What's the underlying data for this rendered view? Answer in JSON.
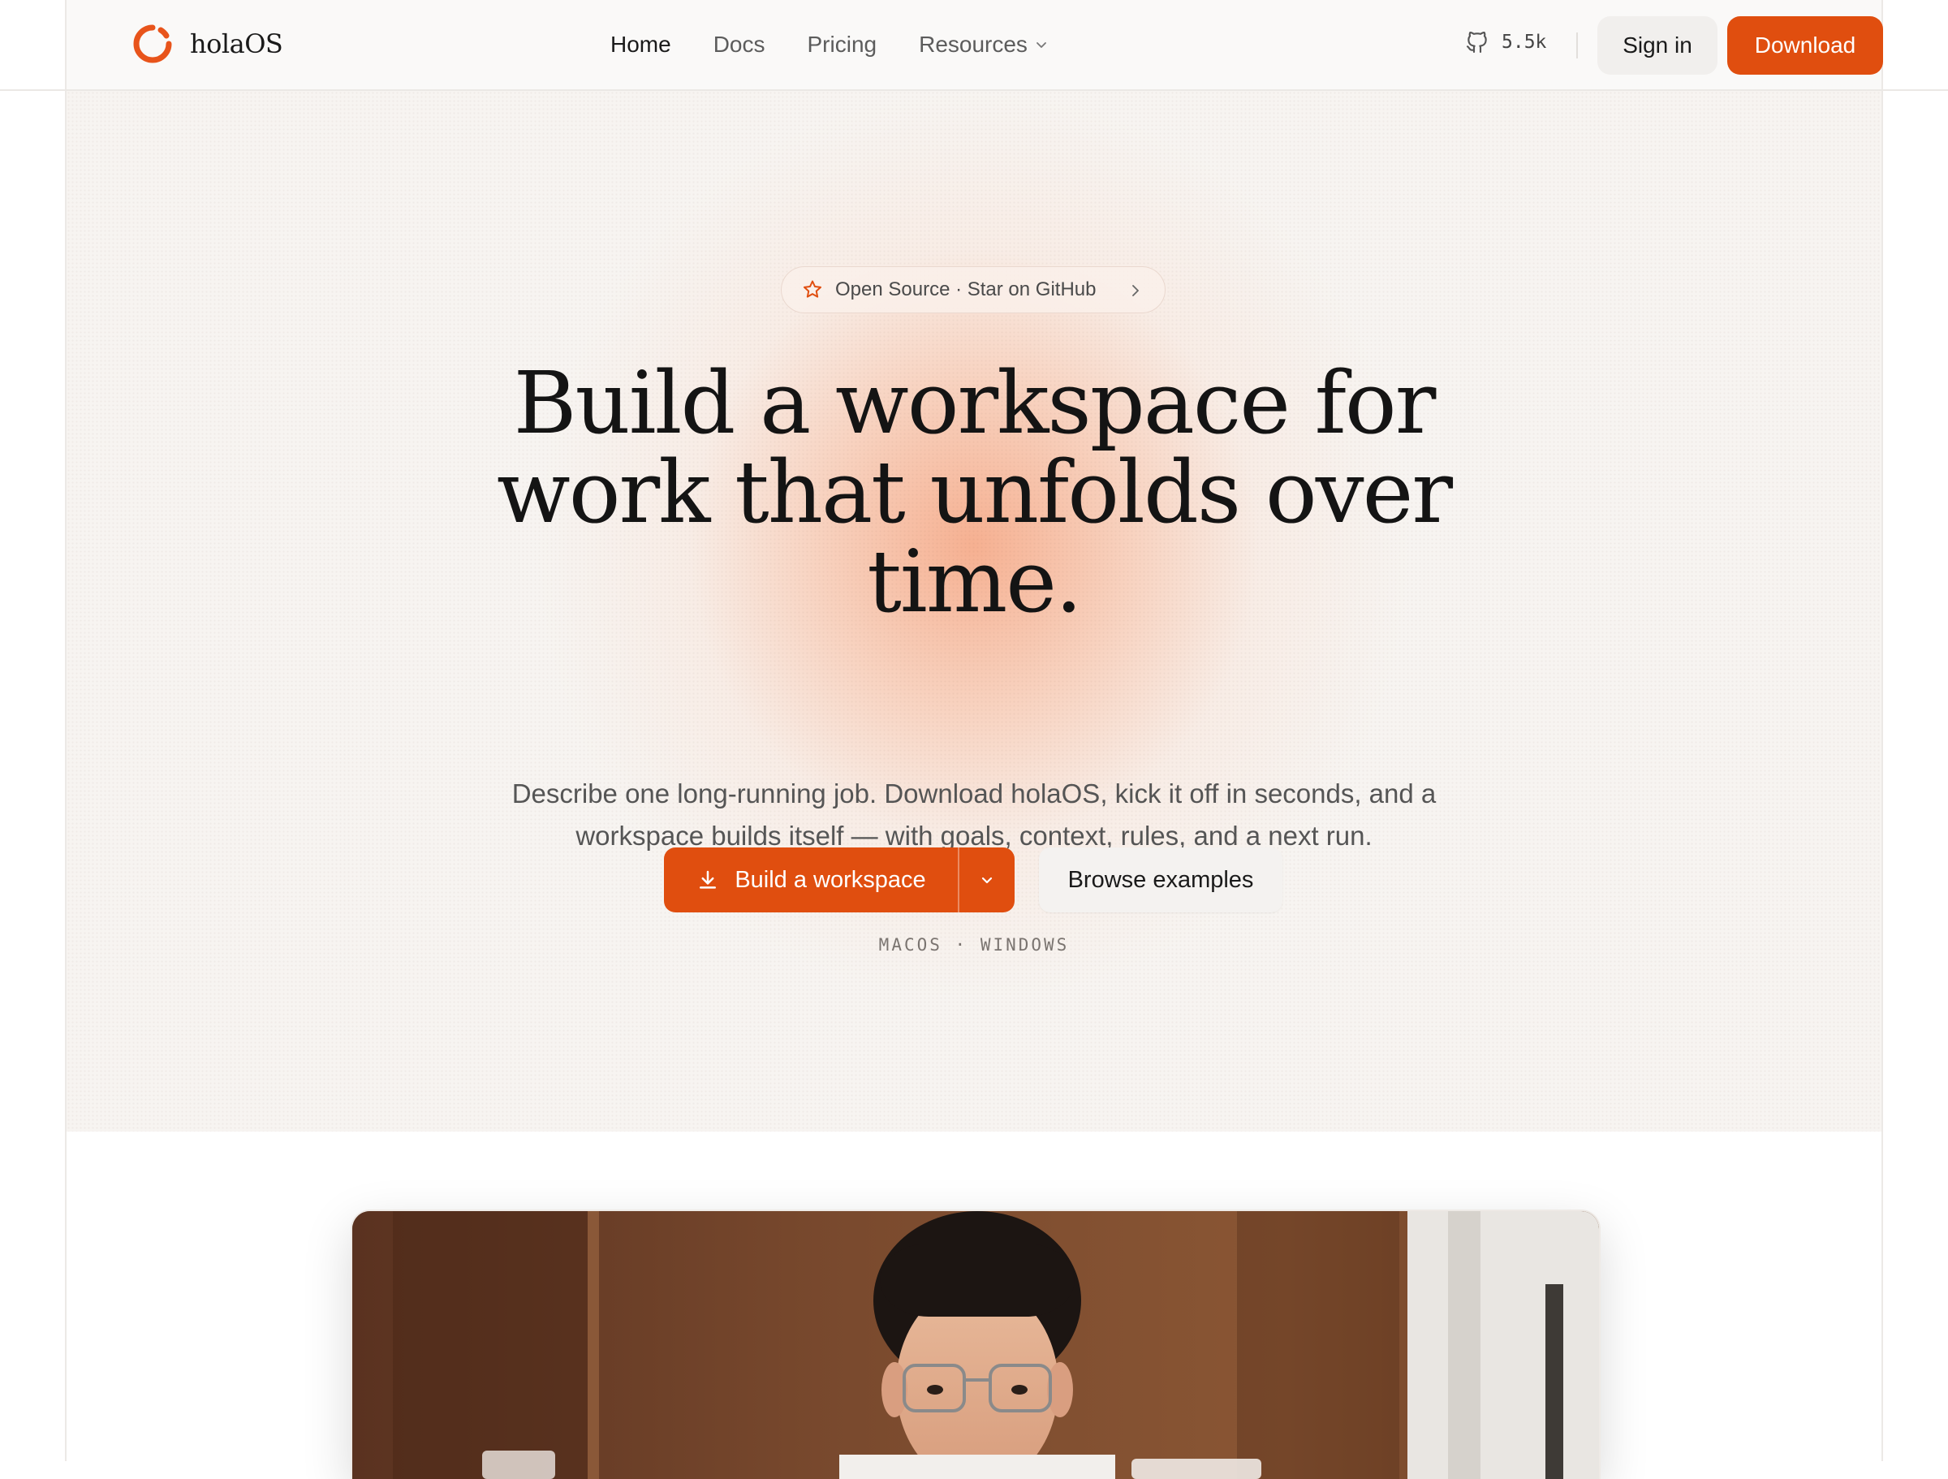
{
  "brand": {
    "name": "holaOS",
    "accent": "#e04e0f"
  },
  "nav": {
    "items": [
      {
        "label": "Home",
        "active": true
      },
      {
        "label": "Docs",
        "active": false
      },
      {
        "label": "Pricing",
        "active": false
      },
      {
        "label": "Resources",
        "active": false,
        "has_dropdown": true
      }
    ]
  },
  "header_actions": {
    "github_stars": "5.5k",
    "sign_in": "Sign in",
    "download": "Download"
  },
  "hero": {
    "badge": "Open Source · Star on GitHub",
    "title_lines": [
      "Build a workspace for",
      "work that unfolds over",
      "time."
    ],
    "subtitle_lines": [
      "Describe one long-running job. Download holaOS, kick it off in seconds, and a",
      "workspace builds itself — with goals, context, rules, and a next run."
    ],
    "primary_cta": "Build a workspace",
    "secondary_cta": "Browse examples",
    "platforms": "MACOS · WINDOWS"
  },
  "media": {
    "alt_subject": "person-portrait"
  }
}
